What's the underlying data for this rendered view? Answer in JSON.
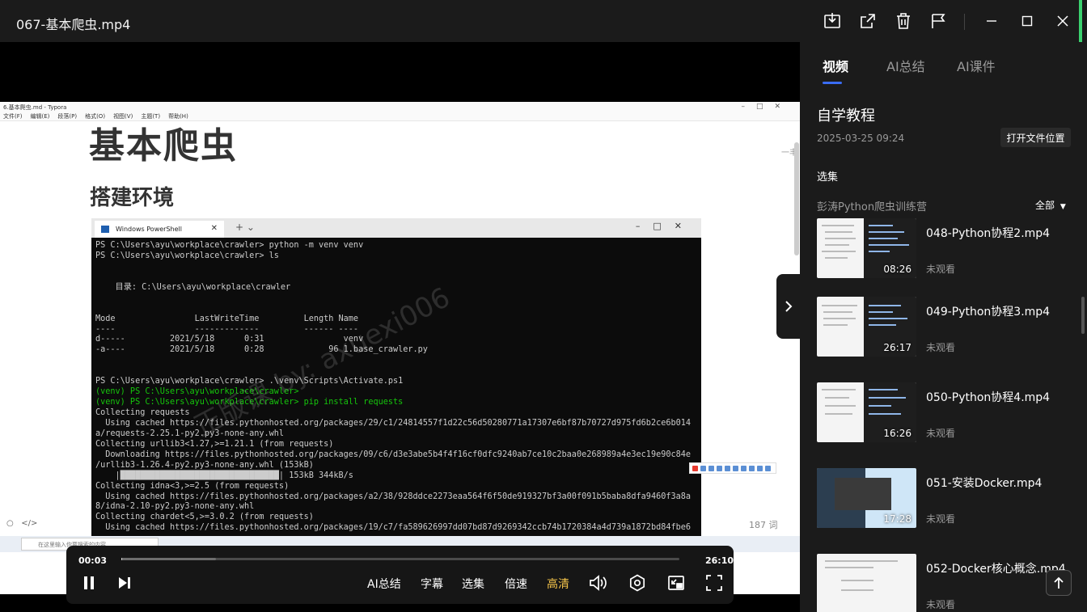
{
  "window": {
    "title": "067-基本爬虫.mp4",
    "buttons": [
      "download-icon",
      "share-icon",
      "delete-icon",
      "pin-icon",
      "minimize-icon",
      "maximize-icon",
      "close-icon"
    ]
  },
  "video_frame": {
    "typora_title": "6.基本爬虫.md - Typora",
    "typora_menu": [
      "文件(F)",
      "编辑(E)",
      "段落(P)",
      "格式(O)",
      "视图(V)",
      "主题(T)",
      "帮助(H)"
    ],
    "heading": "基本爬虫",
    "subheading": "搭建环境",
    "side_text": "一丰",
    "powershell_tab": "Windows PowerShell",
    "terminal_lines": [
      {
        "t": "PS C:\\Users\\ayu\\workplace\\crawler> python -m venv venv",
        "c": ""
      },
      {
        "t": "PS C:\\Users\\ayu\\workplace\\crawler> ls",
        "c": ""
      },
      {
        "t": "",
        "c": ""
      },
      {
        "t": "",
        "c": ""
      },
      {
        "t": "    目录: C:\\Users\\ayu\\workplace\\crawler",
        "c": ""
      },
      {
        "t": "",
        "c": ""
      },
      {
        "t": "",
        "c": ""
      },
      {
        "t": "Mode                LastWriteTime         Length Name",
        "c": ""
      },
      {
        "t": "----                -------------         ------ ----",
        "c": ""
      },
      {
        "t": "d-----         2021/5/18      0:31                venv",
        "c": ""
      },
      {
        "t": "-a----         2021/5/18      0:28             96 1.base_crawler.py",
        "c": ""
      },
      {
        "t": "",
        "c": ""
      },
      {
        "t": "",
        "c": ""
      },
      {
        "t": "PS C:\\Users\\ayu\\workplace\\crawler> .\\venv\\Scripts\\Activate.ps1",
        "c": ""
      },
      {
        "t": "(venv) PS C:\\Users\\ayu\\workplace\\crawler>",
        "c": "g"
      },
      {
        "t": "(venv) PS C:\\Users\\ayu\\workplace\\crawler> pip install requests",
        "c": "g"
      },
      {
        "t": "Collecting requests",
        "c": ""
      },
      {
        "t": "  Using cached https://files.pythonhosted.org/packages/29/c1/24814557f1d22c56d50280771a17307e6bf87b70727d975fd6b2ce6b014",
        "c": ""
      },
      {
        "t": "a/requests-2.25.1-py2.py3-none-any.whl",
        "c": ""
      },
      {
        "t": "Collecting urllib3<1.27,>=1.21.1 (from requests)",
        "c": ""
      },
      {
        "t": "  Downloading https://files.pythonhosted.org/packages/09/c6/d3e3abe5b4f4f16cf0dfc9240ab7ce10c2baa0e268989a4e3ec19e90c84e",
        "c": ""
      },
      {
        "t": "/urllib3-1.26.4-py2.py3-none-any.whl (153kB)",
        "c": ""
      },
      {
        "t": "    |████████████████████████████████| 153kB 344kB/s",
        "c": ""
      },
      {
        "t": "Collecting idna<3,>=2.5 (from requests)",
        "c": ""
      },
      {
        "t": "  Using cached https://files.pythonhosted.org/packages/a2/38/928ddce2273eaa564f6f50de919327bf3a00f091b5baba8dfa9460f3a8a",
        "c": ""
      },
      {
        "t": "8/idna-2.10-py2.py3-none-any.whl",
        "c": ""
      },
      {
        "t": "Collecting chardet<5,>=3.0.2 (from requests)",
        "c": ""
      },
      {
        "t": "  Using cached https://files.pythonhosted.org/packages/19/c7/fa589626997dd07bd87d92693‭42ccb74b1720384a4d739a1872bd84fbe6",
        "c": ""
      }
    ],
    "watermark": "正版课 by: axuexi006",
    "word_count": "187 词",
    "taskbar_search": "在这里输入你要搜索的内容"
  },
  "player": {
    "current_time": "00:03",
    "total_time": "26:10",
    "progress_fraction": 0.002,
    "buffered_fraction": 0.17,
    "buttons": {
      "ai_summary": "AI总结",
      "subtitles": "字幕",
      "episodes": "选集",
      "speed": "倍速",
      "quality": "高清"
    },
    "quality_color": "#f6c54a"
  },
  "panel": {
    "tabs": [
      {
        "label": "视频",
        "active": true
      },
      {
        "label": "AI总结",
        "active": false
      },
      {
        "label": "AI课件",
        "active": false
      }
    ],
    "course_title": "自学教程",
    "course_date": "2025-03-25 09:24",
    "open_folder": "打开文件位置",
    "section_label": "选集",
    "series_name": "彭涛Python爬虫训练营",
    "series_filter": "全部",
    "episodes": [
      {
        "title": "048-Python协程2.mp4",
        "duration": "08:26",
        "status": "未观看"
      },
      {
        "title": "049-Python协程3.mp4",
        "duration": "26:17",
        "status": "未观看"
      },
      {
        "title": "050-Python协程4.mp4",
        "duration": "16:26",
        "status": "未观看"
      },
      {
        "title": "051-安装Docker.mp4",
        "duration": "17:28",
        "status": "未观看"
      },
      {
        "title": "052-Docker核心概念.mp4",
        "duration": "",
        "status": "未观看"
      }
    ],
    "accent_color": "#3a6cf4"
  }
}
